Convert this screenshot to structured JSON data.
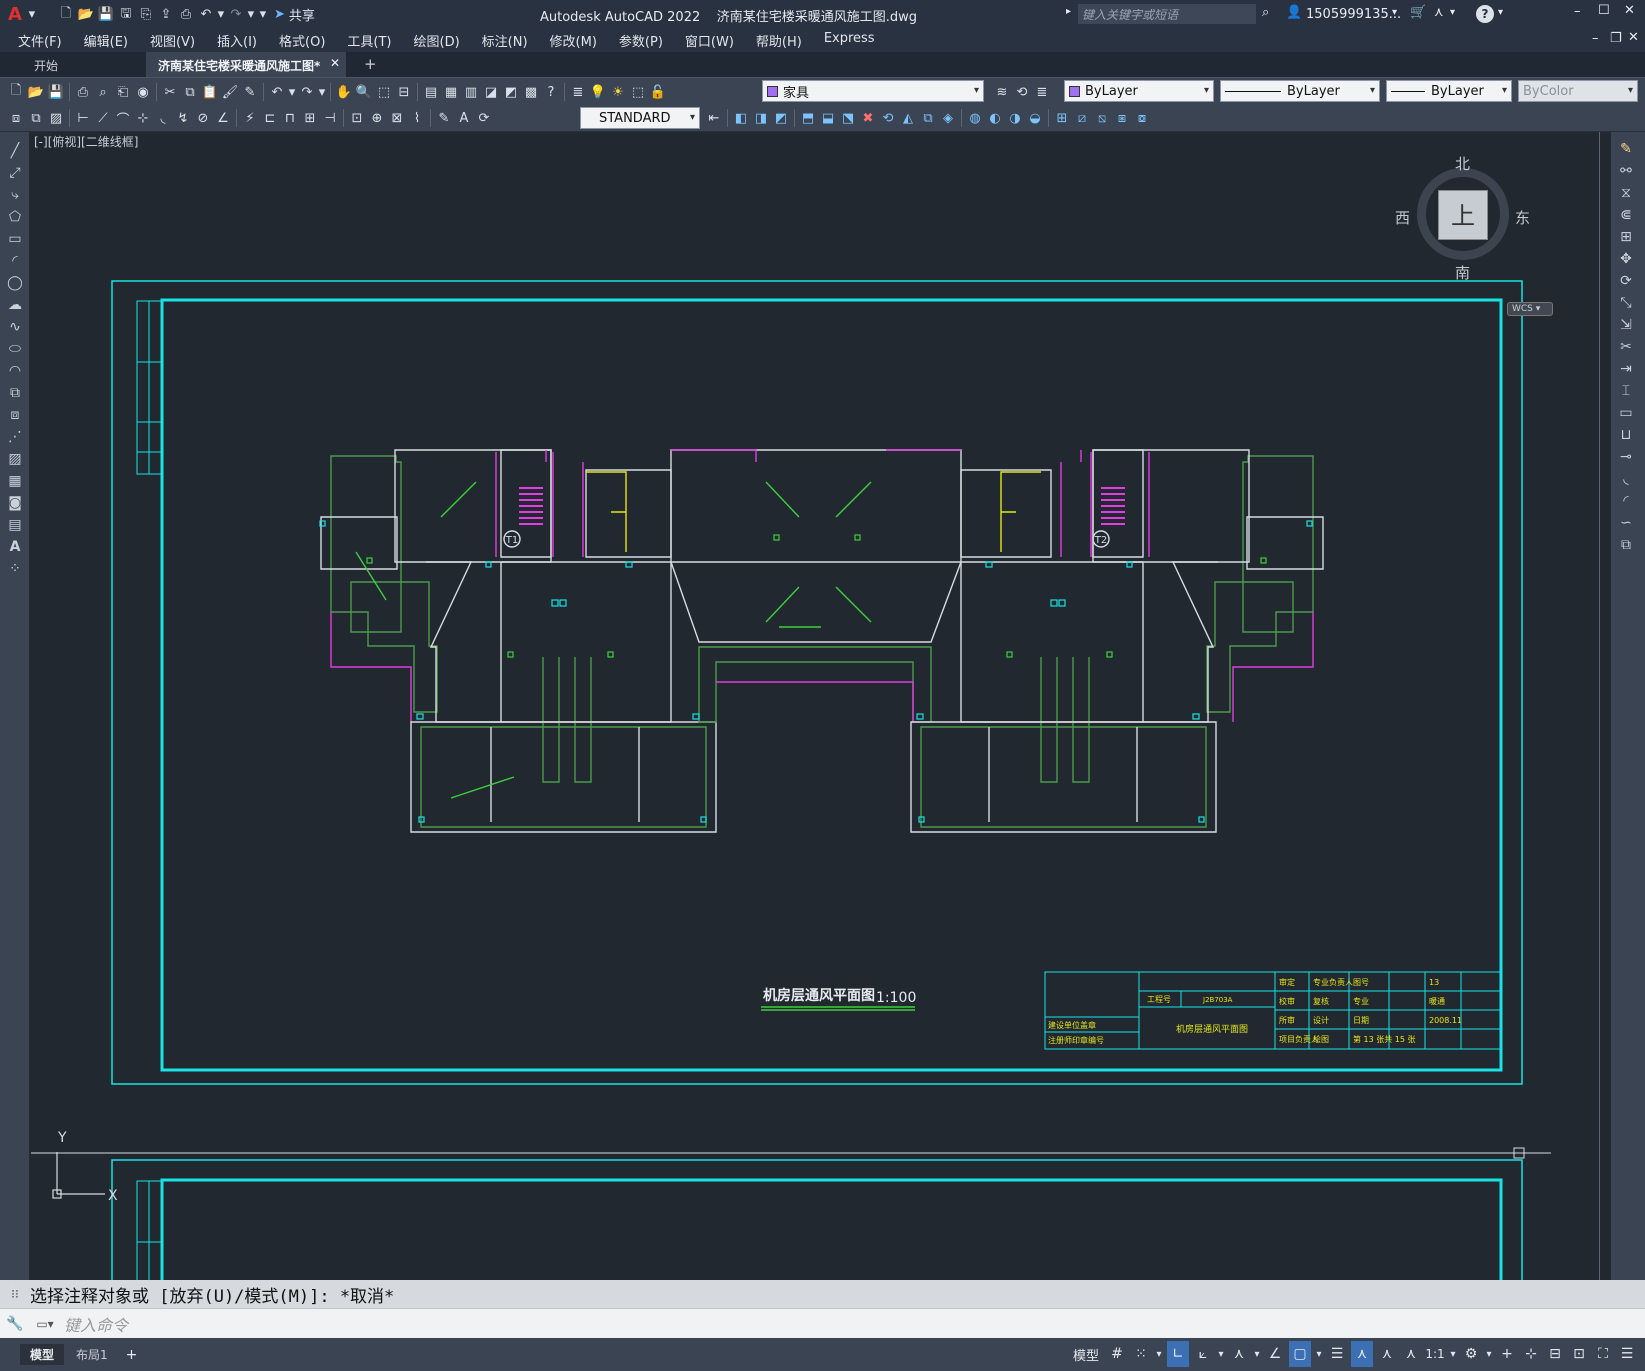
{
  "app": {
    "title": "Autodesk AutoCAD 2022    济南某住宅楼采暖通风施工图.dwg",
    "share_label": "共享",
    "search_placeholder": "键入关键字或短语",
    "user": "1505999135...",
    "help_icon": "?"
  },
  "menu": [
    "文件(F)",
    "编辑(E)",
    "视图(V)",
    "插入(I)",
    "格式(O)",
    "工具(T)",
    "绘图(D)",
    "标注(N)",
    "修改(M)",
    "参数(P)",
    "窗口(W)",
    "帮助(H)",
    "Express"
  ],
  "tabs": {
    "start": "开始",
    "active": "济南某住宅楼采暖通风施工图*",
    "add": "+"
  },
  "toolbar": {
    "layer_value": "家具",
    "color_value": "ByLayer",
    "linetype_value": "ByLayer",
    "lineweight_value": "ByLayer",
    "plotstyle_value": "ByColor",
    "textstyle_value": "STANDARD"
  },
  "viewport": {
    "label": "[-][俯视][二维线框]",
    "viewcube_face": "上",
    "north": "北",
    "south": "南",
    "east": "东",
    "west": "西",
    "wcs": "WCS"
  },
  "drawing": {
    "title": "机房层通风平面图",
    "scale": "1:100",
    "stair_tags": [
      "T1",
      "T2"
    ],
    "tb_sheet_title": "机房层通风平面图",
    "tb_job_label": "工程号",
    "tb_job_no": "J2B703A",
    "tb_rows": [
      [
        "审定",
        "专业负责人",
        "图号",
        "13"
      ],
      [
        "校审",
        "复核",
        "专业",
        "暖通"
      ],
      [
        "所审",
        "设计",
        "日期",
        "2008.11"
      ],
      [
        "项目负责人",
        "绘图",
        "第 13 张共 15 张",
        ""
      ]
    ],
    "tb_left": [
      "建设单位盖章",
      "注册师印章编号"
    ]
  },
  "ucs": {
    "y": "Y",
    "x": "X"
  },
  "command": {
    "history": "选择注释对象或 [放弃(U)/模式(M)]: *取消*",
    "placeholder": "键入命令"
  },
  "status": {
    "model_tab": "模型",
    "layout_tab": "布局1",
    "add": "+",
    "model_button": "模型",
    "scale": "1:1"
  },
  "colors": {
    "cyan": "#19e3e3",
    "green": "#3ecf3e",
    "wall_green": "#4c9a4c",
    "magenta": "#e23ce2",
    "yellow": "#e6e61a",
    "white": "#d8dce0",
    "canvas": "#212830"
  }
}
